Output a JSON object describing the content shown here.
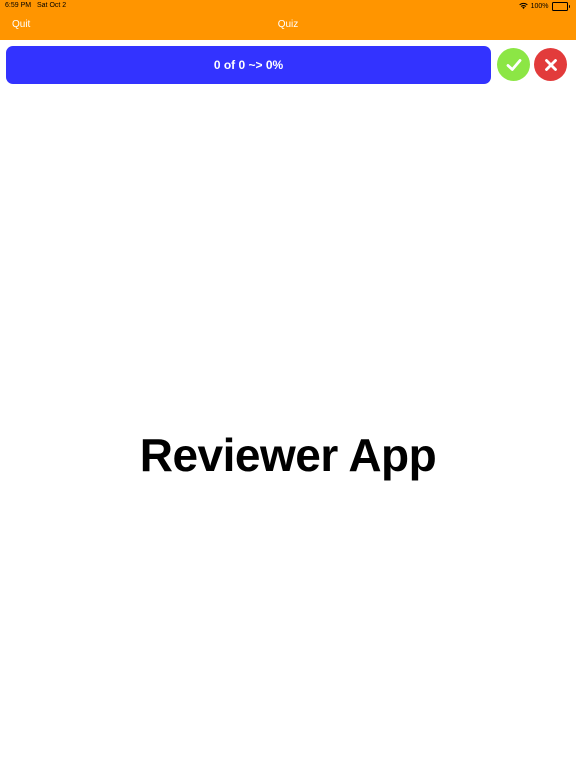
{
  "status_bar": {
    "time": "6:59 PM",
    "date": "Sat Oct 2",
    "battery": "100%",
    "wifi_icon": "wifi-icon",
    "battery_icon": "battery-icon"
  },
  "nav": {
    "quit_label": "Quit",
    "title": "Quiz",
    "background": "#FF9500"
  },
  "progress": {
    "text": "0 of 0 ~> 0%",
    "background": "#3333FF"
  },
  "buttons": {
    "correct": {
      "icon": "checkmark-icon",
      "color": "#8CE645"
    },
    "wrong": {
      "icon": "close-icon",
      "color": "#E23B3B"
    }
  },
  "main": {
    "title": "Reviewer App"
  }
}
